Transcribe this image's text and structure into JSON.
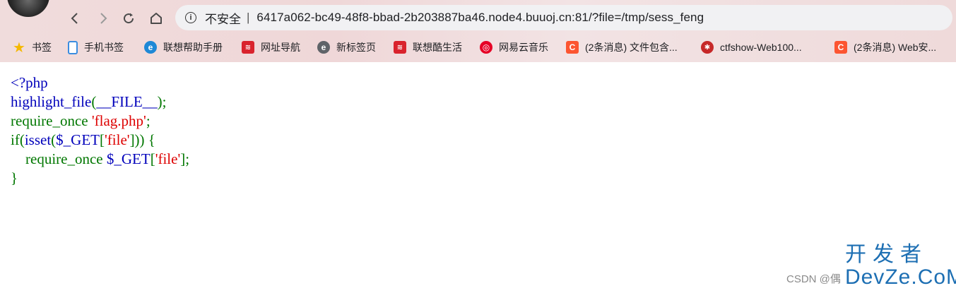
{
  "browser": {
    "address": {
      "security_label": "不安全",
      "separator": "|",
      "url": "6417a062-bc49-48f8-bbad-2b203887ba46.node4.buuoj.cn:81/?file=/tmp/sess_feng"
    },
    "bookmarks": [
      {
        "label": "书签",
        "icon": "star-icon",
        "color": "#f5b800"
      },
      {
        "label": "手机书签",
        "icon": "phone-icon",
        "color": "#3b8de0"
      },
      {
        "label": "联想帮助手册",
        "icon": "edge-icon",
        "color": "#1e88d6"
      },
      {
        "label": "网址导航",
        "icon": "lenovo-nav-icon",
        "color": "#d9232d"
      },
      {
        "label": "新标签页",
        "icon": "new-tab-icon",
        "color": "#5f6368"
      },
      {
        "label": "联想酷生活",
        "icon": "lenovo-life-icon",
        "color": "#d9232d"
      },
      {
        "label": "网易云音乐",
        "icon": "netease-music-icon",
        "color": "#e60026"
      },
      {
        "label": "(2条消息) 文件包含...",
        "icon": "csdn-icon",
        "color": "#fc5531"
      },
      {
        "label": "ctfshow-Web100...",
        "icon": "spiderman-icon",
        "color": "#c62828"
      },
      {
        "label": "(2条消息) Web安...",
        "icon": "csdn-icon",
        "color": "#fc5531"
      }
    ]
  },
  "code": {
    "line1": "<?php",
    "line2_fn": "highlight_file",
    "line2_open": "(",
    "line2_const": "__FILE__",
    "line2_close": ");",
    "line3_kw": "require_once ",
    "line3_str": "'flag.php'",
    "line3_end": ";",
    "line4_if": "if",
    "line4_open": "(",
    "line4_isset": "isset",
    "line4_open2": "(",
    "line4_var": "$_GET",
    "line4_br": "[",
    "line4_str": "'file'",
    "line4_close": "])) {",
    "line5_kw": "    require_once ",
    "line5_var": "$_GET",
    "line5_br": "[",
    "line5_str": "'file'",
    "line5_end": "];",
    "line6": "}"
  },
  "watermark": {
    "csdn_text": "CSDN @偶",
    "brand_top": "开发者",
    "brand_bottom": "DevZe.CoM"
  }
}
